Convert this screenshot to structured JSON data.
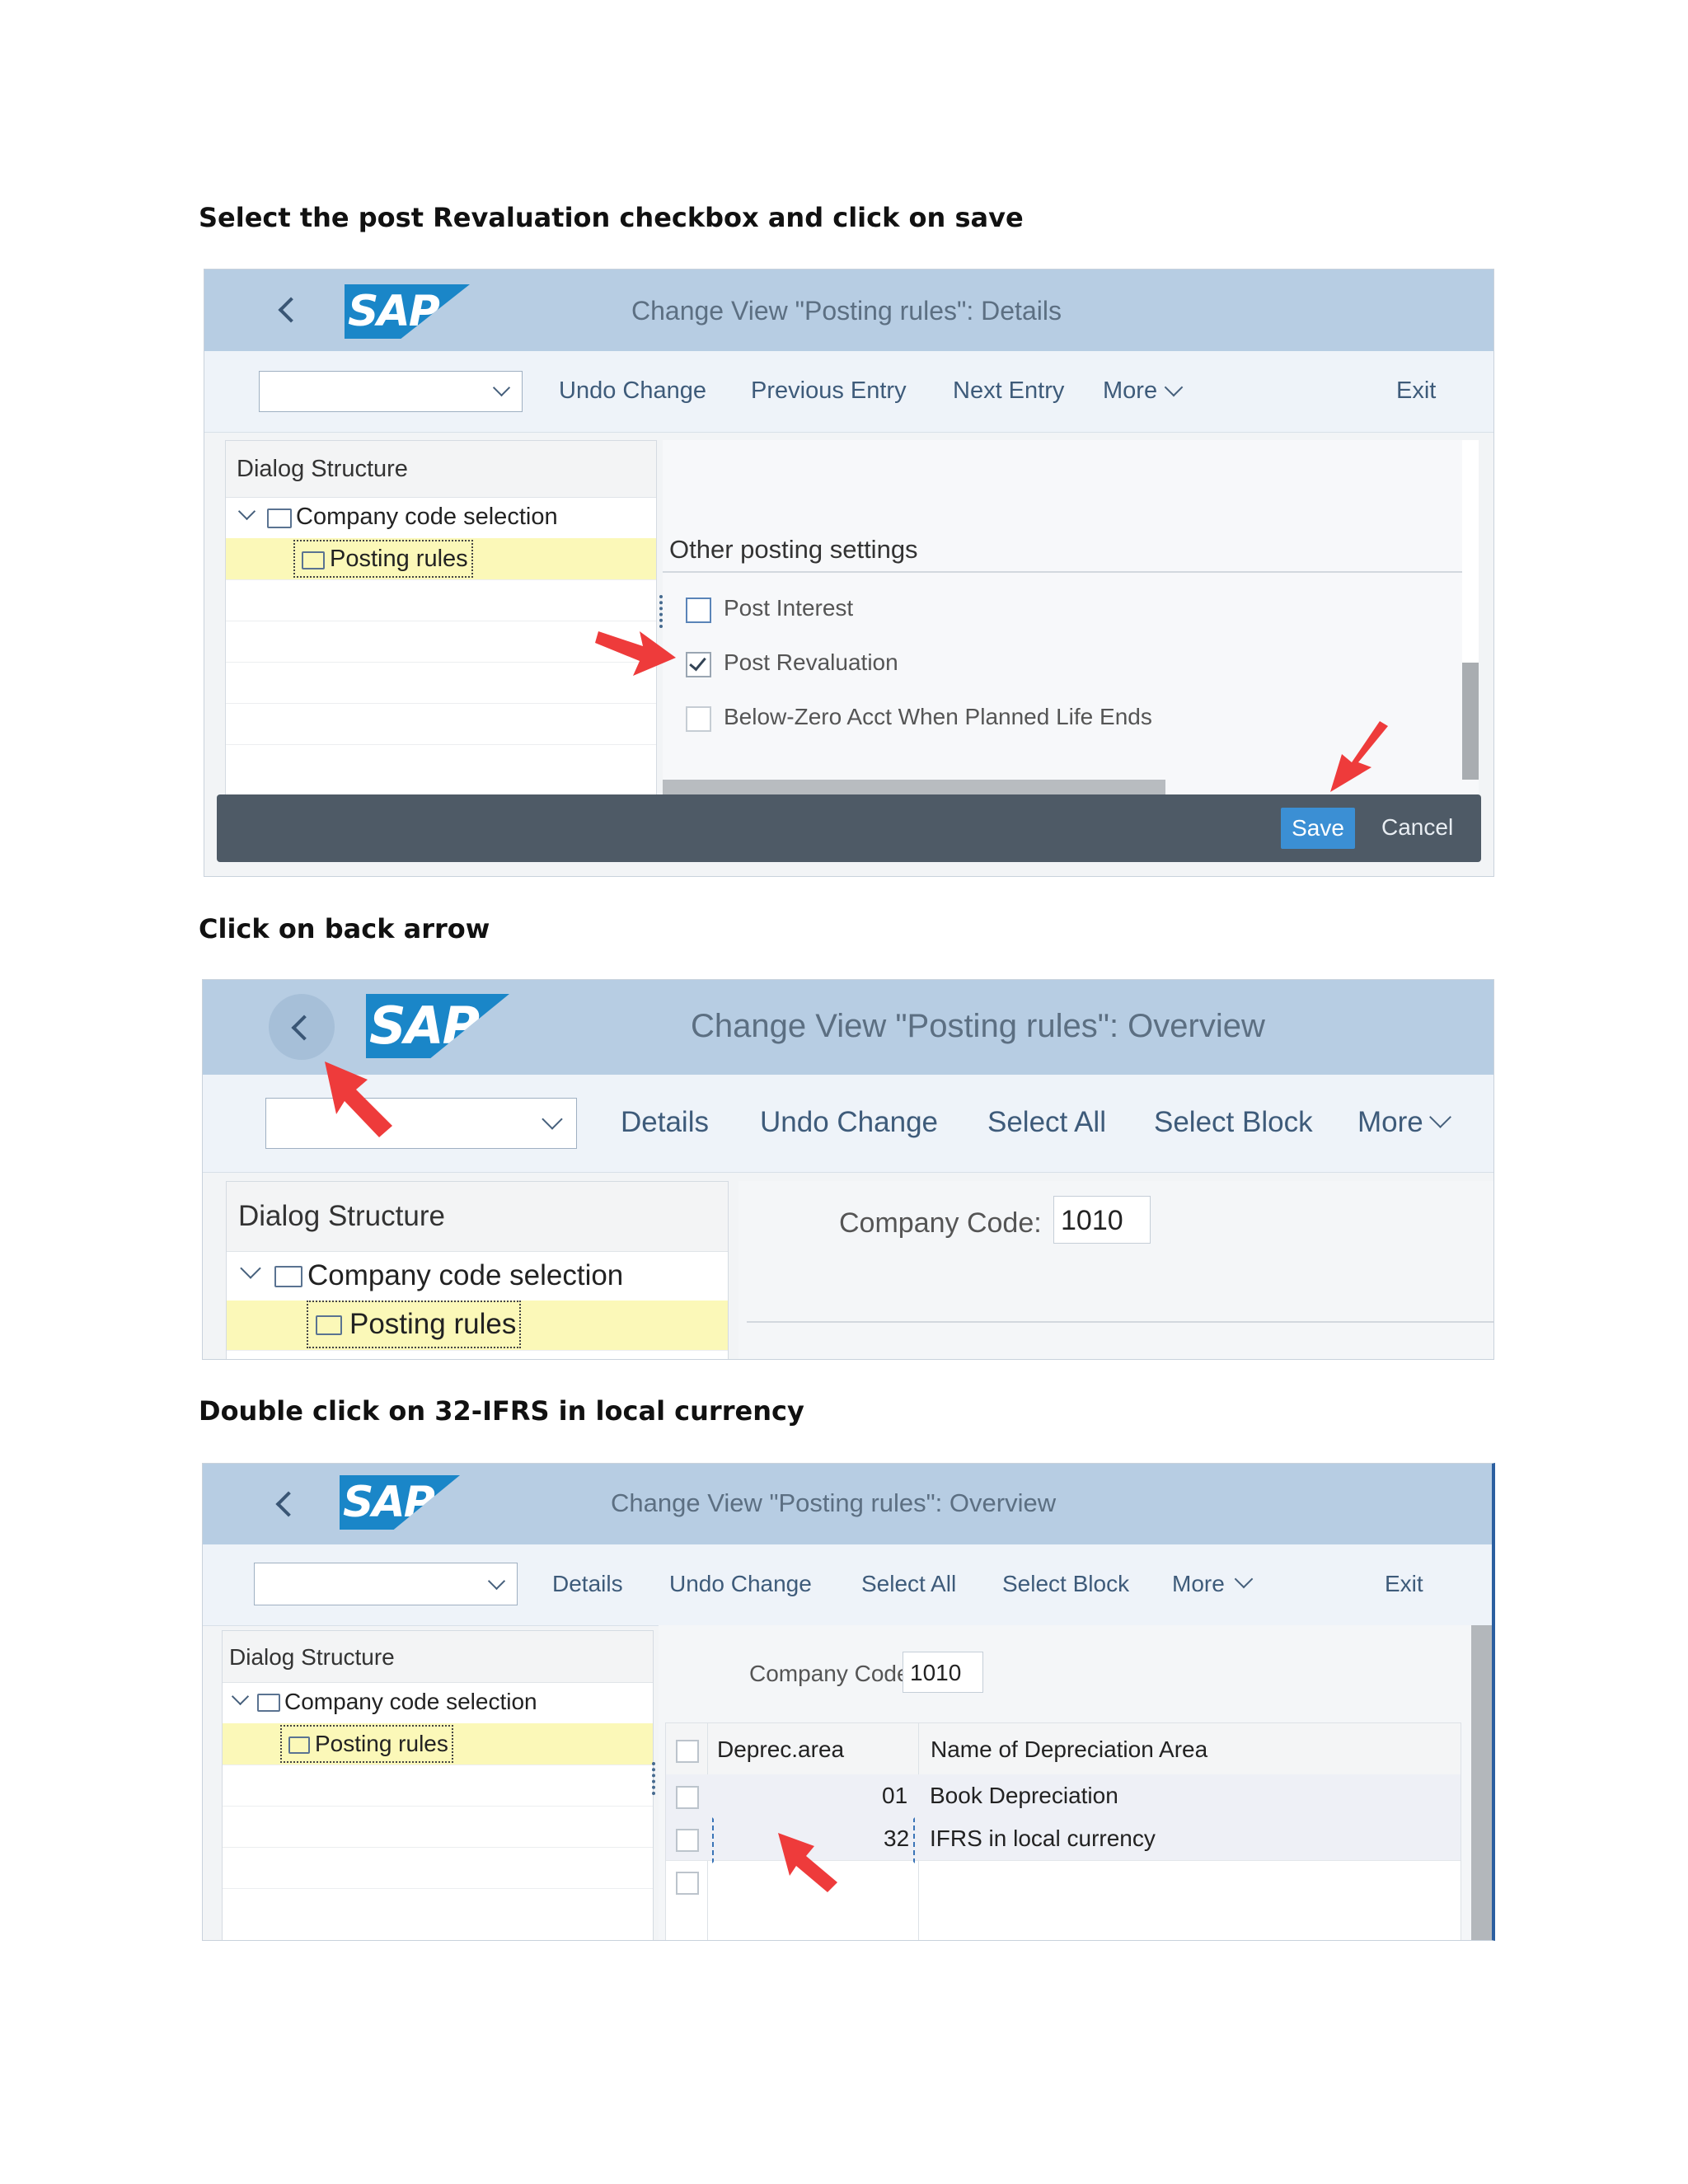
{
  "step1": {
    "caption": "Select the post Revaluation checkbox and click on save",
    "window_title": "Change View \"Posting rules\": Details",
    "toolbar": [
      "Undo Change",
      "Previous Entry",
      "Next Entry",
      "More",
      "Exit"
    ],
    "dialog_structure": "Dialog Structure",
    "tree_company": "Company code selection",
    "tree_posting": "Posting rules",
    "section_title": "Other posting settings",
    "checkboxes": [
      {
        "label": "Post Interest",
        "checked": false
      },
      {
        "label": "Post Revaluation",
        "checked": true
      },
      {
        "label": "Below-Zero Acct When Planned Life Ends",
        "checked": false
      }
    ],
    "save_label": "Save",
    "cancel_label": "Cancel"
  },
  "step2": {
    "caption": "Click on back arrow",
    "window_title": "Change View \"Posting rules\": Overview",
    "toolbar": [
      "Details",
      "Undo Change",
      "Select All",
      "Select Block",
      "More"
    ],
    "dialog_structure": "Dialog Structure",
    "tree_company": "Company code selection",
    "tree_posting": "Posting rules",
    "company_code_label": "Company Code:",
    "company_code_value": "1010"
  },
  "step3": {
    "caption": "Double click on 32-IFRS in local currency",
    "window_title": "Change View \"Posting rules\": Overview",
    "toolbar": [
      "Details",
      "Undo Change",
      "Select All",
      "Select Block",
      "More",
      "Exit"
    ],
    "dialog_structure": "Dialog Structure",
    "tree_company": "Company code selection",
    "tree_posting": "Posting rules",
    "company_code_label": "Company Code:",
    "company_code_value": "1010",
    "table": {
      "headers": [
        "Deprec.area",
        "Name of Depreciation Area"
      ],
      "rows": [
        {
          "area": "01",
          "name": "Book Depreciation"
        },
        {
          "area": "32",
          "name": "IFRS in local currency"
        }
      ]
    }
  },
  "brand": {
    "logo_text": "SAP",
    "accent": "#1a86c8",
    "shell": "#b7cde3",
    "footer": "#4e5a66",
    "save_bg": "#3b8fd4",
    "pointer": "#ee3b3b",
    "selection": "#fbf8b8"
  }
}
